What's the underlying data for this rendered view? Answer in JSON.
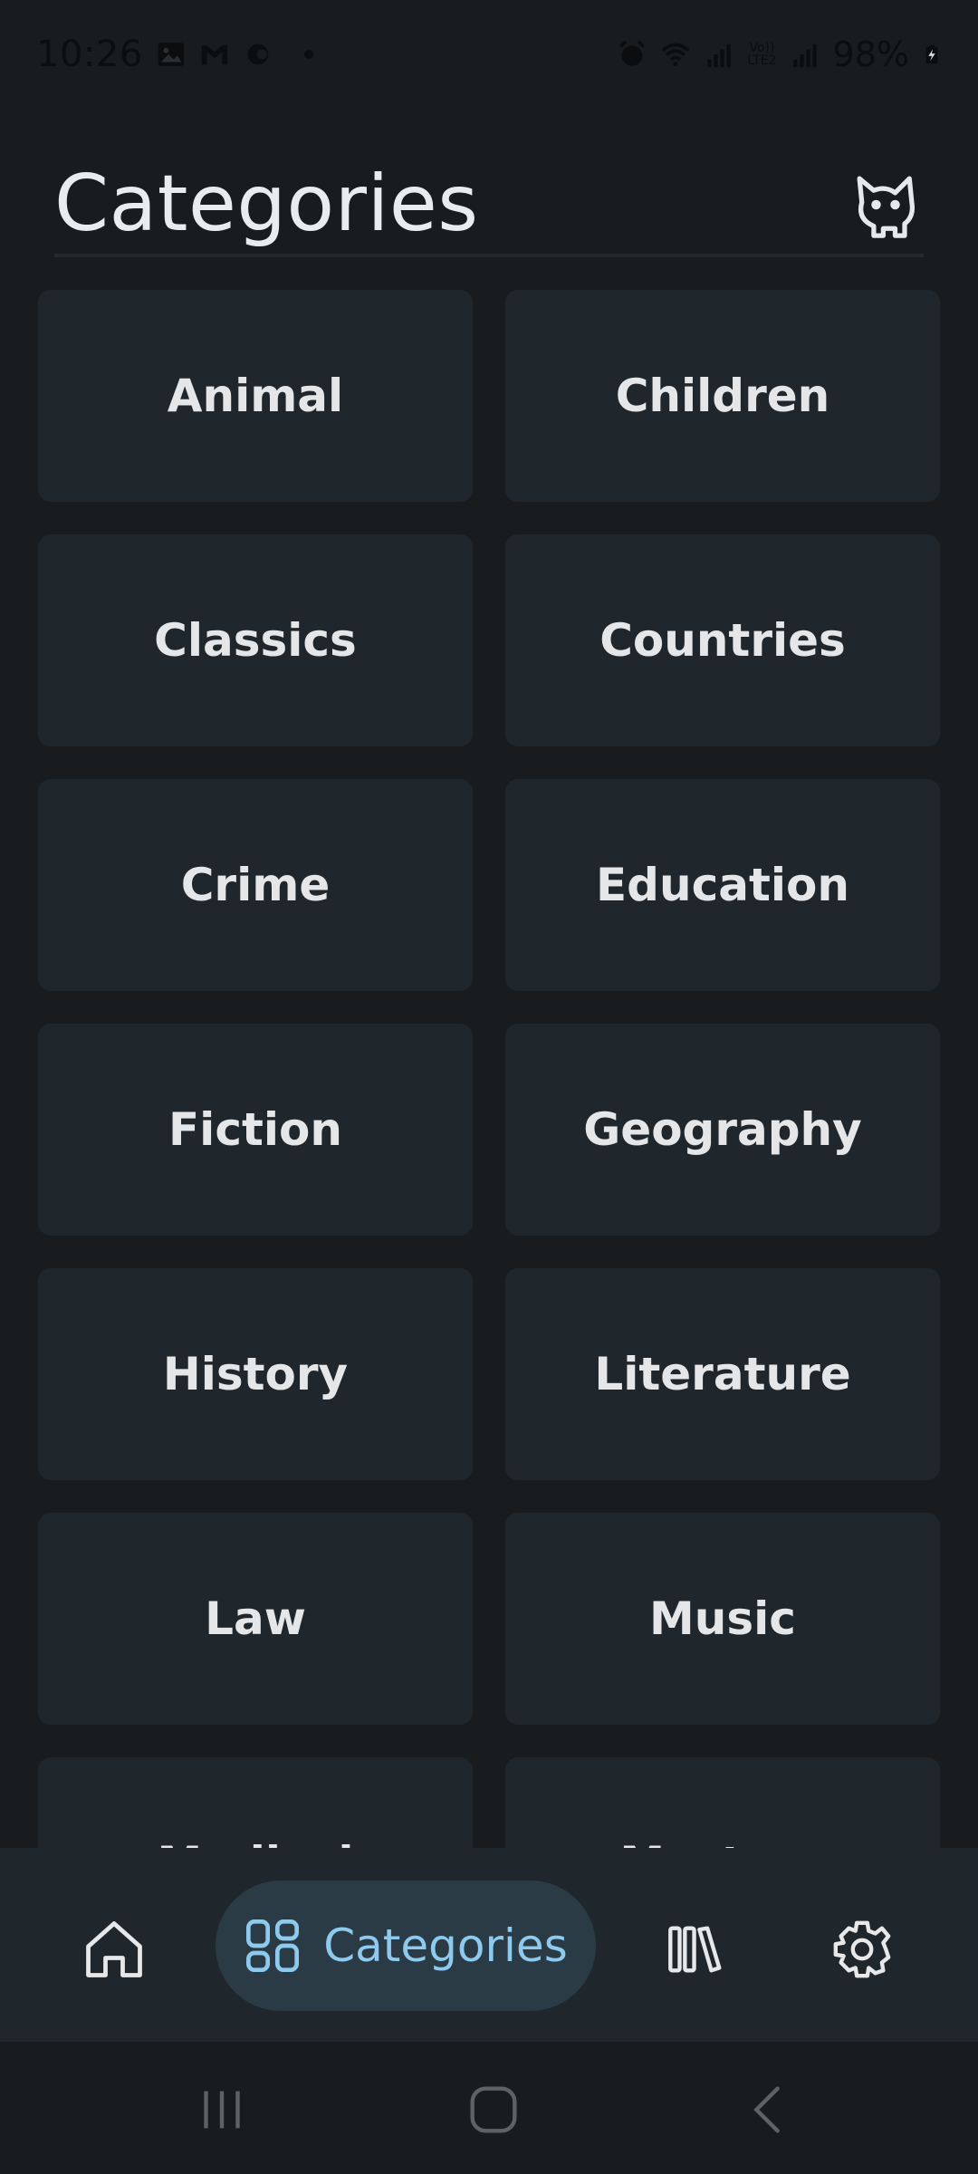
{
  "status_bar": {
    "time": "10:26",
    "network_label_top": "Vo))",
    "network_label_bottom": "LTE2",
    "battery": "98%"
  },
  "header": {
    "title": "Categories"
  },
  "categories": [
    "Animal",
    "Children",
    "Classics",
    "Countries",
    "Crime",
    "Education",
    "Fiction",
    "Geography",
    "History",
    "Literature",
    "Law",
    "Music",
    "Medical",
    "Mystery"
  ],
  "bottom_nav": {
    "active_label": "Categories",
    "accent_color": "#8ec9ee",
    "active_bg": "#2a3b45"
  },
  "icons": {
    "profile": "cat-icon",
    "home": "home-icon",
    "categories": "grid-icon",
    "library": "library-icon",
    "settings": "gear-icon"
  }
}
